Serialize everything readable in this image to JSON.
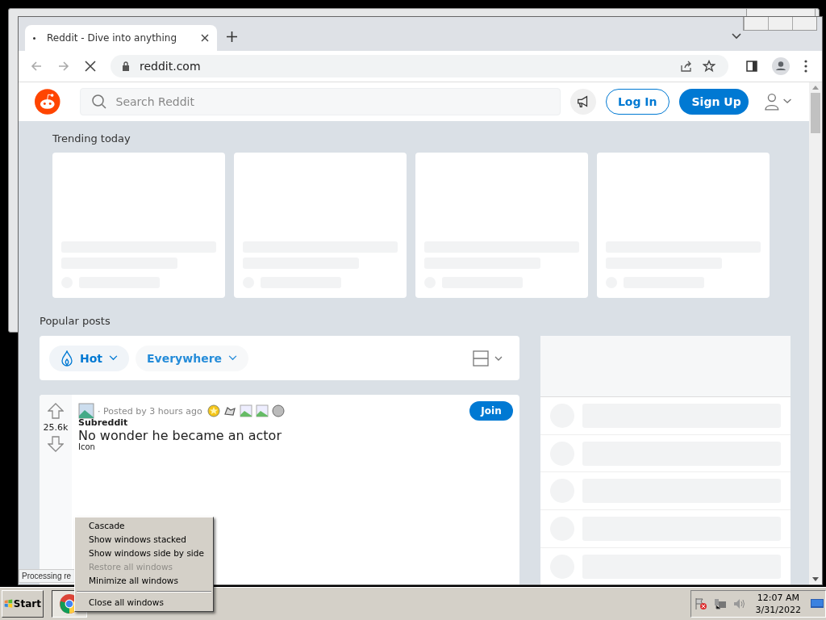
{
  "browser": {
    "tab_title": "Reddit - Dive into anything",
    "address": "reddit.com",
    "status_text": "Processing re"
  },
  "reddit": {
    "search": {
      "placeholder": "Search Reddit"
    },
    "login": "Log In",
    "signup": "Sign Up",
    "trending_title": "Trending today",
    "popular_title": "Popular posts",
    "sort": [
      {
        "label": "Hot",
        "selected": true
      },
      {
        "label": "Everywhere",
        "selected": false
      }
    ],
    "post": {
      "votes": "25.6k",
      "meta": "· Posted by 3 hours ago",
      "subreddit": "Subreddit",
      "icon_alt": "Icon",
      "title": "No wonder he became an actor",
      "join": "Join"
    }
  },
  "context_menu": [
    {
      "kind": "item",
      "label": "Cascade",
      "disabled": false
    },
    {
      "kind": "item",
      "label": "Show windows stacked",
      "disabled": false
    },
    {
      "kind": "item",
      "label": "Show windows side by side",
      "disabled": false
    },
    {
      "kind": "item",
      "label": "Restore all windows",
      "disabled": true
    },
    {
      "kind": "item",
      "label": "Minimize all windows",
      "disabled": false
    },
    {
      "kind": "separator"
    },
    {
      "kind": "item",
      "label": "Close all windows",
      "disabled": false
    }
  ],
  "taskbar": {
    "start": "Start",
    "time": "12:07 AM",
    "date": "3/31/2022"
  }
}
